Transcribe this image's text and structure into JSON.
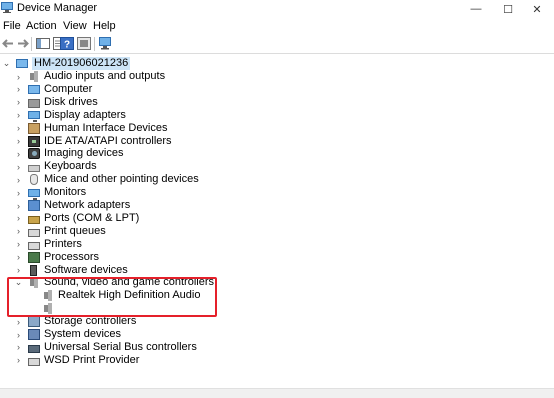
{
  "window": {
    "title": "Device Manager",
    "controls": {
      "minimize": "—",
      "maximize": "☐",
      "close": "✕"
    }
  },
  "menu": [
    "File",
    "Action",
    "View",
    "Help"
  ],
  "toolbar": {
    "buttons": [
      "back-icon",
      "forward-icon",
      "properties-icon",
      "show-hide-console-tree-icon",
      "help-icon",
      "update-driver-icon",
      "scan-hardware-icon"
    ]
  },
  "tree": {
    "root": "HM-201906021236",
    "items": [
      {
        "label": "Audio inputs and outputs",
        "icon": "speaker-icon",
        "expanded": false
      },
      {
        "label": "Computer",
        "icon": "computer-icon",
        "expanded": false
      },
      {
        "label": "Disk drives",
        "icon": "disk-drive-icon",
        "expanded": false
      },
      {
        "label": "Display adapters",
        "icon": "display-adapter-icon",
        "expanded": false
      },
      {
        "label": "Human Interface Devices",
        "icon": "hid-icon",
        "expanded": false
      },
      {
        "label": "IDE ATA/ATAPI controllers",
        "icon": "ide-controller-icon",
        "expanded": false
      },
      {
        "label": "Imaging devices",
        "icon": "camera-icon",
        "expanded": false
      },
      {
        "label": "Keyboards",
        "icon": "keyboard-icon",
        "expanded": false
      },
      {
        "label": "Mice and other pointing devices",
        "icon": "mouse-icon",
        "expanded": false
      },
      {
        "label": "Monitors",
        "icon": "monitor-icon",
        "expanded": false
      },
      {
        "label": "Network adapters",
        "icon": "network-adapter-icon",
        "expanded": false
      },
      {
        "label": "Ports (COM & LPT)",
        "icon": "port-icon",
        "expanded": false
      },
      {
        "label": "Print queues",
        "icon": "print-queue-icon",
        "expanded": false
      },
      {
        "label": "Printers",
        "icon": "printer-icon",
        "expanded": false
      },
      {
        "label": "Processors",
        "icon": "processor-icon",
        "expanded": false
      },
      {
        "label": "Software devices",
        "icon": "software-device-icon",
        "expanded": false
      },
      {
        "label": "Sound, video and game controllers",
        "icon": "speaker-icon",
        "expanded": true,
        "children": [
          {
            "label": "Realtek High Definition Audio",
            "icon": "speaker-icon"
          },
          {
            "label": "",
            "icon": "speaker-icon"
          }
        ]
      },
      {
        "label": "Storage controllers",
        "icon": "storage-controller-icon",
        "expanded": false
      },
      {
        "label": "System devices",
        "icon": "system-device-icon",
        "expanded": false
      },
      {
        "label": "Universal Serial Bus controllers",
        "icon": "usb-icon",
        "expanded": false
      },
      {
        "label": "WSD Print Provider",
        "icon": "printer-icon",
        "expanded": false
      }
    ]
  },
  "colors": {
    "highlight_border": "#e5202a",
    "root_selection": "#cce4f7"
  }
}
